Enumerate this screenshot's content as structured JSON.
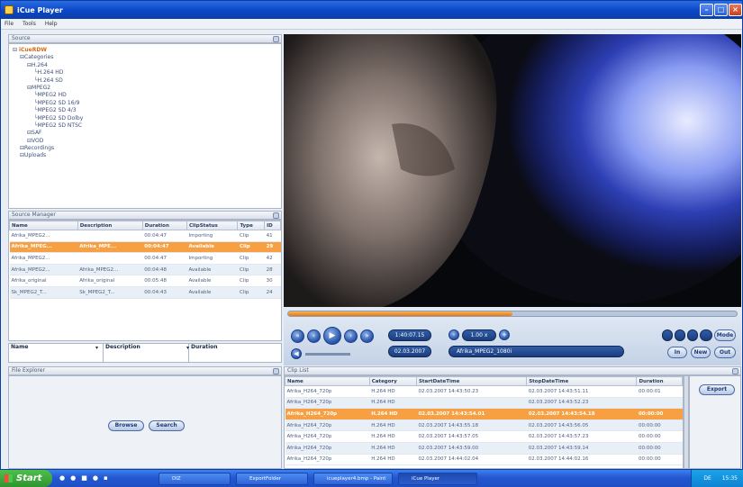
{
  "window": {
    "title": "iCue Player"
  },
  "menu": [
    "File",
    "Tools",
    "Help"
  ],
  "source": {
    "header": "Source",
    "tree": [
      {
        "label": "iCueRDW",
        "depth": 0
      },
      {
        "label": "Categories",
        "depth": 1
      },
      {
        "label": "H.264",
        "depth": 2
      },
      {
        "label": "H.264 HD",
        "depth": 3
      },
      {
        "label": "H.264 SD",
        "depth": 3
      },
      {
        "label": "MPEG2",
        "depth": 2
      },
      {
        "label": "MPEG2 HD",
        "depth": 3
      },
      {
        "label": "MPEG2 SD 16/9",
        "depth": 3
      },
      {
        "label": "MPEG2 SD 4/3",
        "depth": 3
      },
      {
        "label": "MPEG2 SD Dolby",
        "depth": 3
      },
      {
        "label": "MPEG2 SD NTSC",
        "depth": 3
      },
      {
        "label": "SAF",
        "depth": 2
      },
      {
        "label": "VOD",
        "depth": 2
      },
      {
        "label": "Recordings",
        "depth": 1
      },
      {
        "label": "Uploads",
        "depth": 1
      }
    ]
  },
  "source_manager": {
    "header": "Source Manager",
    "columns": [
      "Name",
      "Description",
      "Duration",
      "ClipStatus",
      "Type",
      "ID"
    ],
    "rows": [
      [
        "Afrika_MPEG2...",
        "",
        "00:04:47",
        "Importing",
        "Clip",
        "41"
      ],
      [
        "Afrika_MPEG...",
        "Afrika_MPE...",
        "00:04:47",
        "Available",
        "Clip",
        "29"
      ],
      [
        "Afrika_MPEG2...",
        "",
        "00:04:47",
        "Importing",
        "Clip",
        "42"
      ],
      [
        "Afrika_MPEG2...",
        "Afrika_MPEG2...",
        "00:04:48",
        "Available",
        "Clip",
        "28"
      ],
      [
        "Afrika_original",
        "Afrika_original",
        "00:05:48",
        "Available",
        "Clip",
        "30"
      ],
      [
        "Sk_MPEG2_T...",
        "Sk_MPEG2_T...",
        "00:04:43",
        "Available",
        "Clip",
        "24"
      ]
    ],
    "selected_row": 1,
    "filters": [
      "Name",
      "Description",
      "Duration"
    ]
  },
  "file_explorer": {
    "header": "File Explorer",
    "browse_label": "Browse",
    "search_label": "Search"
  },
  "player": {
    "timecode": "1:40:07.15",
    "speed": "1.00 x",
    "date": "02.03.2007",
    "clip_name": "Afrika_MPEG2_1080i",
    "buttons": {
      "mark_in": "In",
      "new": "New",
      "mark_out": "Out",
      "mode": "Mode"
    },
    "progress_fraction": 0.5
  },
  "clip_list": {
    "header": "Clip List",
    "columns": [
      "Name",
      "Category",
      "StartDateTime",
      "StopDateTime",
      "Duration"
    ],
    "rows": [
      [
        "Afrika_H264_720p",
        "H.264 HD",
        "02.03.2007 14:43:50.23",
        "02.03.2007 14:43:51.11",
        "00:00:01"
      ],
      [
        "Afrika_H264_720p",
        "H.264 HD",
        "",
        "02.03.2007 14:43:52.23",
        ""
      ],
      [
        "Afrika_H264_720p",
        "H.264 HD",
        "02.03.2007 14:43:54.01",
        "02.03.2007 14:43:54.18",
        "00:00:00"
      ],
      [
        "Afrika_H264_720p",
        "H.264 HD",
        "02.03.2007 14:43:55.18",
        "02.03.2007 14:43:56.05",
        "00:00:00"
      ],
      [
        "Afrika_H264_720p",
        "H.264 HD",
        "02.03.2007 14:43:57.05",
        "02.03.2007 14:43:57.23",
        "00:00:00"
      ],
      [
        "Afrika_H264_720p",
        "H.264 HD",
        "02.03.2007 14:43:59.00",
        "02.03.2007 14:43:59.14",
        "00:00:00"
      ],
      [
        "Afrika_H264_720p",
        "H.264 HD",
        "02.03.2007 14:44:02.04",
        "02.03.2007 14:44:02.16",
        "00:00:00"
      ]
    ],
    "selected_row": 2,
    "export_label": "Export"
  },
  "taskbar": {
    "start_label": "Start",
    "tasks": [
      "DIZ",
      "ExportFolder",
      "icueplayer4.bmp - Paint",
      "iCue Player"
    ],
    "clock": "15:35",
    "lang": "DE"
  }
}
